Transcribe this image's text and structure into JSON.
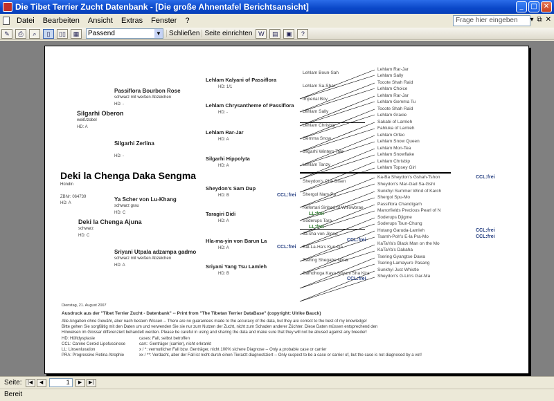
{
  "window": {
    "title": "Die Tibet Terrier Zucht Datenbank - [Die große Ahnentafel Berichtsansicht]"
  },
  "menu": {
    "items": [
      "Datei",
      "Bearbeiten",
      "Ansicht",
      "Extras",
      "Fenster",
      "?"
    ],
    "help_placeholder": "Frage hier eingeben"
  },
  "toolbar": {
    "zoom_value": "Passend",
    "close_label": "Schließen",
    "setup_label": "Seite einrichten"
  },
  "report": {
    "subject": {
      "name": "Deki la Chenga Daka Sengma",
      "sex": "Hündin",
      "zb": "ZBNr: 064739",
      "hd": "HD: A"
    },
    "gen1": [
      {
        "name": "Silgarhi Oberon",
        "sub": "weiß/zobel",
        "hd": "HD: A"
      },
      {
        "name": "Deki la Chenga Ajuna",
        "sub": "schwarz",
        "hd": "HD: C"
      }
    ],
    "gen2": [
      {
        "name": "Passiflora Bourbon Rose",
        "sub": "schwarz mit weißen Abzeichen",
        "hd": "HD: -"
      },
      {
        "name": "Silgarhi Zerlina",
        "sub": "",
        "hd": "HD: -"
      },
      {
        "name": "Ya Scher von Lu-Khang",
        "sub": "schwarz grau",
        "hd": "HD: C"
      },
      {
        "name": "Sriyani Utpala adzampa gadmo",
        "sub": "schwarz mit weißen Abzeichen",
        "hd": "HD: A"
      }
    ],
    "gen3": [
      {
        "name": "Lehlam Kalyani of Passiflora",
        "hd": "HD: 1/1"
      },
      {
        "name": "Lehlam Chrysantheme of Passiflora",
        "hd": "HD: -"
      },
      {
        "name": "Lehlam Rar-Jar",
        "hd": "HD: A"
      },
      {
        "name": "Silgarhi Hippolyta",
        "hd": "HD: A"
      },
      {
        "name": "Sheydon's Sam Dup",
        "hd": "HD: B",
        "ccl": "CCL:frei"
      },
      {
        "name": "Taragiri Didi",
        "hd": "HD: A"
      },
      {
        "name": "Hla-ma-yin von Barun La",
        "hd": "HD: A",
        "ccl": "CCL:frei"
      },
      {
        "name": "Sriyani Yang Tsu Lamleh",
        "hd": "HD: B"
      }
    ],
    "gen4": [
      {
        "name": "Lehlam Boun-Sah"
      },
      {
        "name": "Lehlam Sa-Shar"
      },
      {
        "name": "Imperial Boy"
      },
      {
        "name": "Lehlam Sally"
      },
      {
        "name": "Lehlam Chrisbip"
      },
      {
        "name": "Gemma Snow"
      },
      {
        "name": "Silgarhi Winters Tale"
      },
      {
        "name": "Lehlam Tanzy"
      },
      {
        "name": "Sheydon's Che-Bisen"
      },
      {
        "name": "Shergol Nam-Pa"
      },
      {
        "name": "Nefertari Sinbad of Willowbrae",
        "lcl": "LL:frei"
      },
      {
        "name": "Soderups Tara",
        "lcl": "LL:frei"
      },
      {
        "name": "Ja-sha von Jilong",
        "ccl": "CCL:frei"
      },
      {
        "name": "Bai-La-Ha's Kun-Ga"
      },
      {
        "name": "Tsering Shegabe Nima"
      },
      {
        "name": "Samdhoga Kaya Sriyani Sha Kira",
        "ccl": "CCL:frei"
      }
    ],
    "gen5": [
      {
        "name": "Lehlam Rar-Jar"
      },
      {
        "name": "Lehlam Sally"
      },
      {
        "name": "Tocote Shah Raid"
      },
      {
        "name": "Lehlam Choice"
      },
      {
        "name": "Lehlam Rar-Jar"
      },
      {
        "name": "Lehlam Gemma Tu"
      },
      {
        "name": "Tocote Shah Raid"
      },
      {
        "name": "Lehlam Gracie"
      },
      {
        "name": "Sakabi of Lamleh"
      },
      {
        "name": "Fahluka of Lamleh"
      },
      {
        "name": "Lehlam Orfeo"
      },
      {
        "name": "Lehlam Snow Queen"
      },
      {
        "name": "Lehlam Mon-Tea"
      },
      {
        "name": "Lehlam Snowflake"
      },
      {
        "name": "Lehlam Chrisbip"
      },
      {
        "name": "Lehlam Topsey Girl"
      },
      {
        "name": "Ka-Ba Sheydon's Gshah-Tshon",
        "ccl": "CCL:frei"
      },
      {
        "name": "Sheydon's Mar-Gad Sa-Gshi"
      },
      {
        "name": "Sunkhyi Summer Wind of Karch"
      },
      {
        "name": "Shergol Spu-Mo"
      },
      {
        "name": "Passiflora Chandigarh"
      },
      {
        "name": "Manorfields Precious Pearl of N"
      },
      {
        "name": "Soderups Djigme"
      },
      {
        "name": "Soderups Tsun-Chung"
      },
      {
        "name": "Hotang Garuda-Lamleh",
        "ccl": "CCL:frei"
      },
      {
        "name": "Tsamh-Poh's E-la Pra-Mo",
        "ccl": "CCL:frei"
      },
      {
        "name": "KaTaYa's Black Man on the Mo"
      },
      {
        "name": "KaTaYa's Dakaha"
      },
      {
        "name": "Tsering Gyangtse Dawa"
      },
      {
        "name": "Tsering Lamayuro Pasang"
      },
      {
        "name": "Sunkhyi Just Whistle"
      },
      {
        "name": "Sheydon's G-Lin's Gar-Ma"
      }
    ],
    "footer": {
      "date": "Dienstag, 21. August 2007",
      "printline": "Ausdruck aus der \"Tibet Terrier Zucht - Datenbank\" -- Print from \"The Tibetan Terrier DataBase\" (copyright: Ulrike Bauck)",
      "line1": "Alle Angaben ohne Gewähr, aber nach bestem Wissen -- There are no guarantees made to the accuracy of the data, but they are correct to the best of my knowledge!",
      "line2": "Bitte gehen Sie sorgfältig mit den Daten um und verwenden Sie sie nur zum Nutzen der Zucht, nicht zum Schaden anderer Züchter. Diese Daten müssen entsprechend den",
      "line3": "Hinweisen im Glossar differenziert behandelt werden. Please be careful in using and sharing the data and make sure that they will not be abused against any breeder!",
      "legend": [
        {
          "key": "HD:  Hüftdysplasie",
          "val": "cases:   Fall, selbst betroffen"
        },
        {
          "key": "CCL: Canine Ceroid Lipofuscinose",
          "val": "carr.:   Genträger (carrier), nicht erkrankt"
        },
        {
          "key": "LL:   Linsenluxation",
          "val": "x / *: vermutlicher Fall bzw. Genträger, nicht 100% sichere Diagnose -- Only a probable case or carrier"
        },
        {
          "key": "PRA: Progressive Retina Atrophie",
          "val": "xx / **: Verdacht, aber der Fall ist nicht durch einen Tierarzt diagnostiziert -- Only suspect to be a case or carrier of, but the case is not diagnosed by a vet!"
        }
      ]
    }
  },
  "nav": {
    "page_label": "Seite:",
    "page_value": "1"
  },
  "status": {
    "text": "Bereit"
  },
  "colors": {
    "titlebar": "#0a47c8",
    "chrome": "#ece9d8",
    "workspace": "#808080",
    "ccl": "#223c80",
    "ll": "#2d7a2d"
  }
}
